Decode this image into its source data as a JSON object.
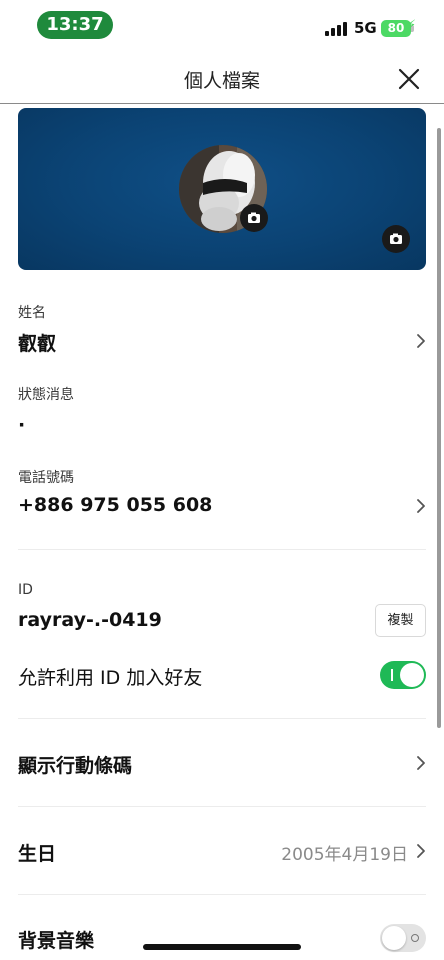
{
  "status": {
    "time": "13:37",
    "network": "5G",
    "battery": "80"
  },
  "header": {
    "title": "個人檔案"
  },
  "profile": {
    "name_label": "姓名",
    "name": "叡叡",
    "status_label": "狀態消息",
    "status_message": "·",
    "phone_label": "電話號碼",
    "phone": "+886 975 055 608",
    "id_label": "ID",
    "id": "rayray-.-0419",
    "copy_label": "複製",
    "allow_id_label": "允許利用 ID 加入好友",
    "allow_id_enabled": true,
    "qr_label": "顯示行動條碼",
    "birthday_label": "生日",
    "birthday": "2005年4月19日",
    "music_label": "背景音樂",
    "music_enabled": false
  },
  "icons": {
    "close": "close-icon",
    "camera": "camera-icon",
    "chevron": "chevron-right-icon"
  },
  "colors": {
    "accent_green": "#1fb956",
    "status_pill": "#1f8a3c",
    "cover_blue": "#0b4374"
  }
}
